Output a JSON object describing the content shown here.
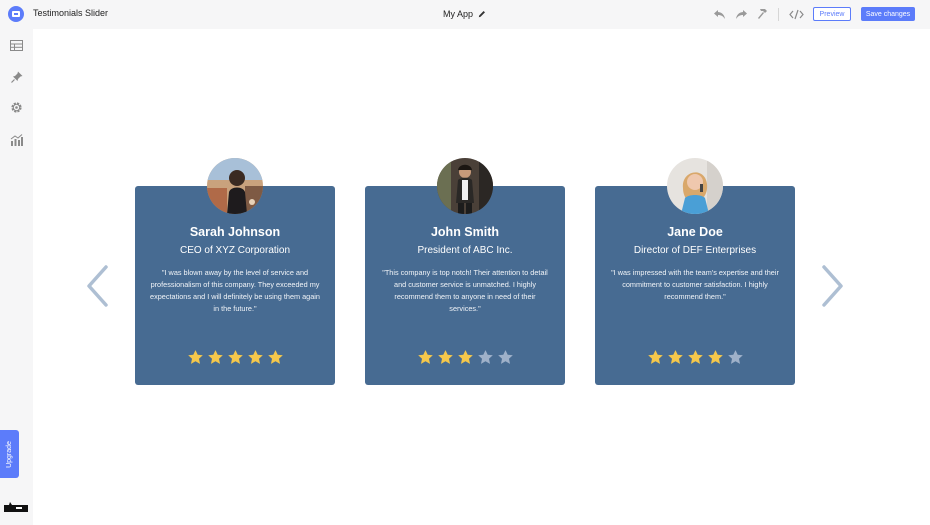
{
  "app": {
    "title": "Testimonials Slider",
    "project_name": "My App"
  },
  "toolbar": {
    "preview_label": "Preview",
    "save_label": "Save changes"
  },
  "sidebar": {
    "upgrade_label": "Upgrade"
  },
  "colors": {
    "accent": "#5c7cfa",
    "card_bg": "#476b92",
    "star_filled": "#f5c84b",
    "star_empty": "#9fb1c9",
    "arrow": "#aebfd3"
  },
  "testimonials": [
    {
      "name": "Sarah Johnson",
      "role": "CEO of XYZ Corporation",
      "quote": "\"I was blown away by the level of service and professionalism of this company. They exceeded my expectations and I will definitely be using them again in the future.\"",
      "rating": 5,
      "max_rating": 5
    },
    {
      "name": "John Smith",
      "role": "President of ABC Inc.",
      "quote": "\"This company is top notch! Their attention to detail and customer service is unmatched. I highly recommend them to anyone in need of their services.\"",
      "rating": 3,
      "max_rating": 5
    },
    {
      "name": "Jane Doe",
      "role": "Director of DEF Enterprises",
      "quote": "\"I was impressed with the team's expertise and their commitment to customer satisfaction. I highly recommend them.\"",
      "rating": 4,
      "max_rating": 5
    }
  ]
}
